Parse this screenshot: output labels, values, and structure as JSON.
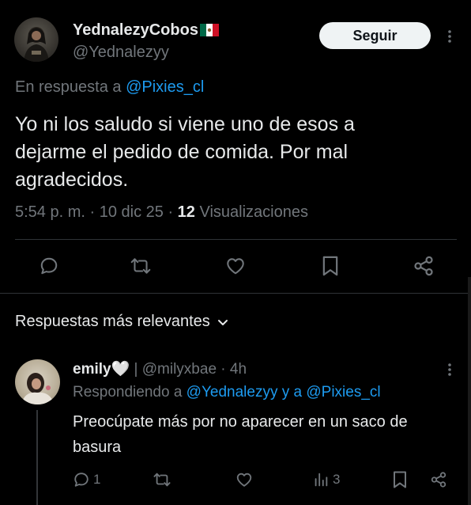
{
  "tweet": {
    "author_name": "YednalezyCobos",
    "author_handle": "@Yednalezyy",
    "follow_label": "Seguir",
    "reply_prefix": "En respuesta a ",
    "reply_to": "@Pixies_cl",
    "text": "Yo ni los saludo si viene uno de esos a dejarme el pedido de comida. Por mal agradecidos.",
    "time": "5:54 p. m.",
    "sep1": " · ",
    "date": "10 dic 25",
    "sep2": " · ",
    "views_count": "12",
    "views_label": " Visualizaciones",
    "icons": [
      "reply-icon",
      "retweet-icon",
      "like-icon",
      "bookmark-icon",
      "share-icon"
    ]
  },
  "replies_section": {
    "sort_label": "Respuestas más relevantes"
  },
  "reply": {
    "author_name": "emily🤍",
    "pipe": " | ",
    "author_handle": "@milyxbae",
    "sep": " · ",
    "age": "4h",
    "replying_prefix": "Respondiendo a ",
    "replying_to_1": "@Yednalezyy",
    "replying_and": " y a ",
    "replying_to_2": "@Pixies_cl",
    "text": "Preocúpate más por no aparecer en un saco de basura",
    "reply_count": "1",
    "views_count": "3"
  },
  "colors": {
    "background": "#000000",
    "text": "#e7e9ea",
    "muted": "#71767b",
    "link": "#1d9bf0",
    "divider": "#2f3336"
  }
}
